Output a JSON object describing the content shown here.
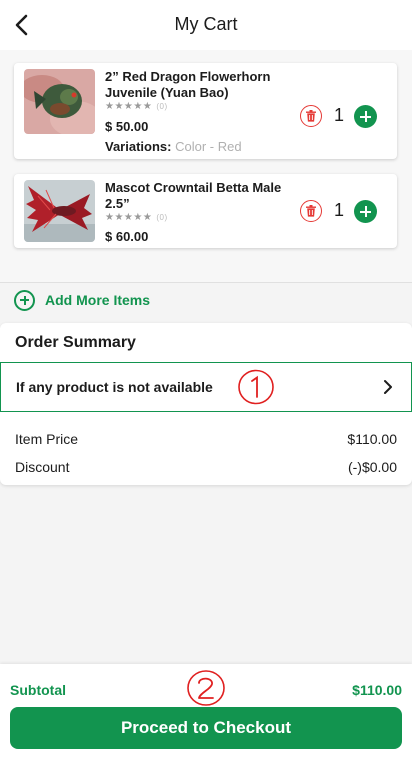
{
  "header": {
    "title": "My Cart",
    "back_icon": "chevron-left-icon"
  },
  "cart": {
    "items": [
      {
        "name": "2” Red Dragon Flowerhorn Juvenile (Yuan Bao)",
        "rating_stars": "★★★★★",
        "rating_count": "(0)",
        "price": "$ 50.00",
        "variations_label": "Variations:",
        "variations_value": "Color - Red",
        "quantity": "1",
        "image": "flowerhorn-fish-photo"
      },
      {
        "name": "Mascot Crowntail Betta Male 2.5”",
        "rating_stars": "★★★★★",
        "rating_count": "(0)",
        "price": "$ 60.00",
        "quantity": "1",
        "image": "betta-fish-photo"
      }
    ],
    "add_more_label": "Add More Items"
  },
  "summary": {
    "title": "Order Summary",
    "availability_label": "If any product is not available",
    "annotation_1": "①",
    "rows": [
      {
        "label": "Item Price",
        "value": "$110.00"
      },
      {
        "label": "Discount",
        "value": "(-)$0.00"
      }
    ]
  },
  "footer": {
    "subtotal_label": "Subtotal",
    "subtotal_value": "$110.00",
    "annotation_2": "②",
    "checkout_label": "Proceed to Checkout"
  },
  "colors": {
    "brand_green": "#12944f",
    "delete_red": "#e53935",
    "annotation_red": "#e02020"
  }
}
